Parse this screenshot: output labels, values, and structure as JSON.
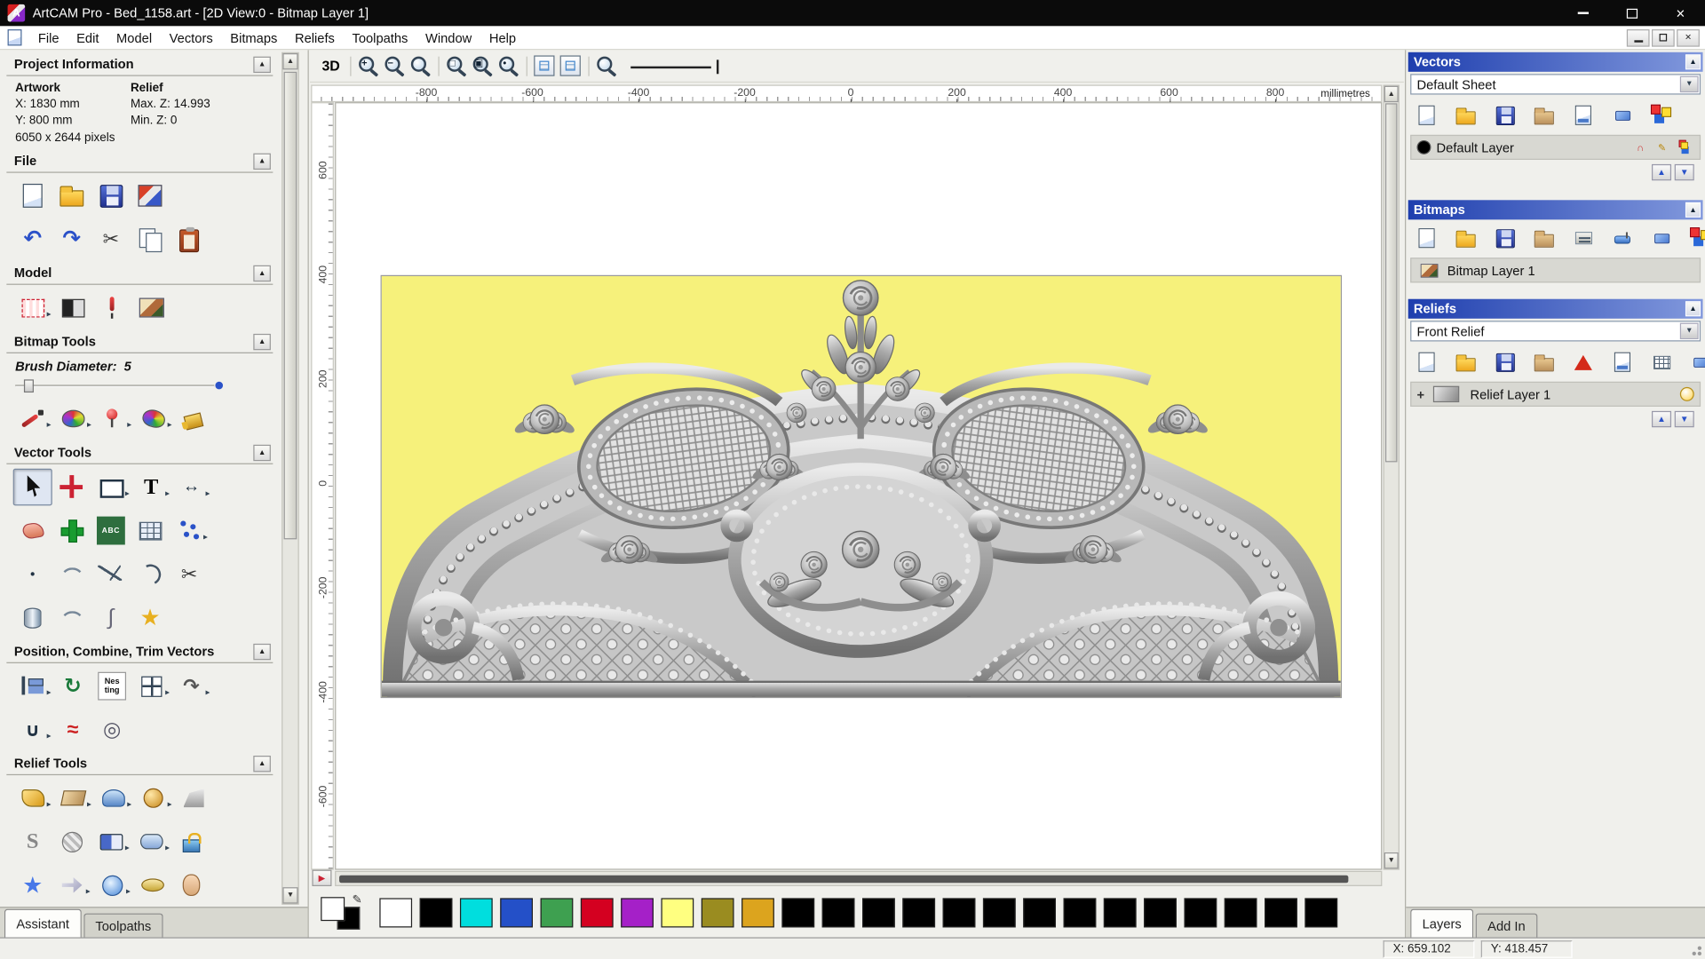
{
  "window": {
    "title": "ArtCAM Pro - Bed_1158.art - [2D View:0 - Bitmap Layer 1]",
    "logo_letter": "A"
  },
  "menu": {
    "items": [
      "File",
      "Edit",
      "Model",
      "Vectors",
      "Bitmaps",
      "Reliefs",
      "Toolpaths",
      "Window",
      "Help"
    ]
  },
  "glyphs": {
    "close": "×",
    "up": "▲",
    "down": "▼",
    "left": "◀",
    "right": "▶",
    "flyout": "▸",
    "dropdown": "▼",
    "undo": "↶",
    "redo": "↷",
    "cut": "✂",
    "trim": "✂",
    "pencil": "✎",
    "star": "★",
    "r-star": "★",
    "text": "T",
    "measure": "↔",
    "spinring": "↻",
    "rotcopy": "↷",
    "join": "∪",
    "weld": "≈",
    "abc": "ABC",
    "nesting": "Nes\nting",
    "magnet": "∩",
    "flourish": "∫",
    "spiral": "◎",
    "r-s": "S",
    "smalldot": "•",
    "plus": "+"
  },
  "left_panel": {
    "project_info": {
      "title": "Project Information",
      "artwork_label": "Artwork",
      "relief_label": "Relief",
      "x": "X: 1830 mm",
      "y": "Y: 800 mm",
      "max_z": "Max. Z: 14.993",
      "min_z": "Min. Z: 0",
      "pixels": "6050 x 2644 pixels"
    },
    "sections": {
      "file": "File",
      "model": "Model",
      "bitmap_tools": "Bitmap Tools",
      "vector_tools": "Vector Tools",
      "position_combine": "Position, Combine, Trim Vectors",
      "relief_tools": "Relief Tools"
    },
    "brush": {
      "label": "Brush Diameter:",
      "value": "5"
    },
    "strips": {
      "file1": [
        {
          "n": "new-model",
          "t": "page"
        },
        {
          "n": "open-model",
          "t": "folder"
        },
        {
          "n": "save-model",
          "t": "floppy"
        },
        {
          "n": "import-export-model",
          "t": "model3d"
        }
      ],
      "file2": [
        {
          "n": "undo",
          "t": "undo"
        },
        {
          "n": "redo",
          "t": "redo"
        },
        {
          "n": "cut",
          "t": "cut"
        },
        {
          "n": "copy",
          "t": "copy"
        },
        {
          "n": "paste",
          "t": "paste"
        }
      ],
      "model": [
        {
          "n": "set-model-size",
          "t": "modelgrid",
          "f": 1
        },
        {
          "n": "invert-model",
          "t": "invert"
        },
        {
          "n": "adjust-model",
          "t": "pin2"
        },
        {
          "n": "load-reference-image",
          "t": "picture"
        }
      ],
      "bitmap": [
        {
          "n": "paint",
          "t": "brush",
          "f": 1
        },
        {
          "n": "colour-palette",
          "t": "palette",
          "f": 1
        },
        {
          "n": "draw",
          "t": "pin",
          "f": 1
        },
        {
          "n": "flood-fill",
          "t": "palette2",
          "f": 1
        },
        {
          "n": "bucket-fill",
          "t": "bucket"
        }
      ],
      "vector1": [
        {
          "n": "select-vectors",
          "t": "select",
          "active": 1
        },
        {
          "n": "transform-vectors",
          "t": "transform"
        },
        {
          "n": "create-rectangle",
          "t": "rect",
          "f": 1
        },
        {
          "n": "create-text",
          "t": "text",
          "f": 1
        },
        {
          "n": "measure",
          "t": "measure",
          "f": 1
        }
      ],
      "vector2": [
        {
          "n": "offset-vectors",
          "t": "pinkblob"
        },
        {
          "n": "node-editing",
          "t": "greencross"
        },
        {
          "n": "text-in-box",
          "t": "abc"
        },
        {
          "n": "paste-in-grid",
          "t": "grid2"
        },
        {
          "n": "snap-points",
          "t": "dots",
          "f": 1
        }
      ],
      "vector3": [
        {
          "n": "create-dot",
          "t": "smalldot"
        },
        {
          "n": "create-curve",
          "t": "curve"
        },
        {
          "n": "create-polyline",
          "t": "polyline"
        },
        {
          "n": "create-arc",
          "t": "arcline"
        },
        {
          "n": "trim-vectors",
          "t": "trim"
        }
      ],
      "vector4": [
        {
          "n": "create-cylinder",
          "t": "cylinder"
        },
        {
          "n": "wrap-vectors",
          "t": "curve"
        },
        {
          "n": "create-flourish",
          "t": "flourish"
        },
        {
          "n": "create-star",
          "t": "star"
        }
      ],
      "poscomb1": [
        {
          "n": "align-vectors",
          "t": "align",
          "f": 1
        },
        {
          "n": "rotate-vectors",
          "t": "spinring"
        },
        {
          "n": "nesting",
          "t": "nesting"
        },
        {
          "n": "block-copy",
          "t": "blockcopy",
          "f": 1
        },
        {
          "n": "rotate-copy",
          "t": "rotcopy",
          "f": 1
        }
      ],
      "poscomb2": [
        {
          "n": "join-vectors",
          "t": "join",
          "f": 1
        },
        {
          "n": "weld-vectors",
          "t": "weld"
        },
        {
          "n": "create-spiral",
          "t": "spiral"
        }
      ],
      "relief1": [
        {
          "n": "shape-editor",
          "t": "r-gold",
          "f": 1
        },
        {
          "n": "angled-plane",
          "t": "r-plane",
          "f": 1
        },
        {
          "n": "smooth-relief",
          "t": "r-smooth",
          "f": 1
        },
        {
          "n": "sculpt-relief",
          "t": "r-sculpt",
          "f": 1
        },
        {
          "n": "scale-relief",
          "t": "r-scale"
        }
      ],
      "relief2": [
        {
          "n": "smooth-tool",
          "t": "r-s"
        },
        {
          "n": "texture-relief",
          "t": "r-weave"
        },
        {
          "n": "offset-relief",
          "t": "r-book",
          "f": 1
        },
        {
          "n": "relief-envelope",
          "t": "r-env",
          "f": 1
        },
        {
          "n": "wrap-relief",
          "t": "r-lock"
        }
      ],
      "relief3": [
        {
          "n": "two-rail-sweep",
          "t": "r-star"
        },
        {
          "n": "extrude-relief",
          "t": "r-extrude",
          "f": 1
        },
        {
          "n": "spin-relief",
          "t": "r-spin",
          "f": 1
        },
        {
          "n": "turn-relief",
          "t": "r-turn"
        },
        {
          "n": "face-wizard",
          "t": "r-face"
        }
      ],
      "relief4": [
        {
          "n": "relief-extra-1",
          "t": "r-sculpt"
        },
        {
          "n": "relief-extra-2",
          "t": "r-weave"
        },
        {
          "n": "relief-extra-3",
          "t": "r-smooth"
        },
        {
          "n": "relief-extra-4",
          "t": "r-gold"
        }
      ]
    },
    "tabs": [
      "Assistant",
      "Toolpaths"
    ]
  },
  "canvas": {
    "toolbar": {
      "view3d": "3D"
    },
    "ruler_unit": "millimetres",
    "h_ticks": [
      "-800",
      "-600",
      "-400",
      "-200",
      "0",
      "200",
      "400",
      "600",
      "800"
    ],
    "v_ticks": [
      "600",
      "400",
      "200",
      "0",
      "-200",
      "-400",
      "-600"
    ]
  },
  "right_panel": {
    "vectors": {
      "title": "Vectors",
      "sheet": "Default Sheet",
      "layer": "Default Layer",
      "toolbar": [
        {
          "n": "new-vector-layer",
          "t": "page"
        },
        {
          "n": "open-vector-layer",
          "t": "folder"
        },
        {
          "n": "save-vector-layer",
          "t": "floppy"
        },
        {
          "n": "import-vectors",
          "t": "folder2"
        },
        {
          "n": "export-vectors",
          "t": "page2"
        },
        {
          "n": "delete-vector-layer",
          "t": "eraser"
        },
        {
          "n": "merge-vector-layers",
          "t": "merge"
        }
      ],
      "layer_icons": [
        {
          "n": "toggle-layer-snap",
          "t": "magnet"
        },
        {
          "n": "edit-layer-colour",
          "t": "pencil"
        },
        {
          "n": "merge-layer",
          "t": "merge"
        }
      ]
    },
    "bitmaps": {
      "title": "Bitmaps",
      "layer": "Bitmap Layer 1",
      "toolbar": [
        {
          "n": "new-bitmap-layer",
          "t": "page"
        },
        {
          "n": "open-bitmap-layer",
          "t": "folder"
        },
        {
          "n": "save-bitmap-layer",
          "t": "floppy"
        },
        {
          "n": "import-bitmap",
          "t": "folder2"
        },
        {
          "n": "adjust-bitmap",
          "t": "slider"
        },
        {
          "n": "paint-bitmap",
          "t": "roller"
        },
        {
          "n": "delete-bitmap-layer",
          "t": "eraser"
        },
        {
          "n": "merge-bitmap-layers",
          "t": "merge"
        }
      ]
    },
    "reliefs": {
      "title": "Reliefs",
      "dropdown": "Front Relief",
      "layer": "Relief Layer 1",
      "toolbar": [
        {
          "n": "new-relief-layer",
          "t": "page"
        },
        {
          "n": "open-relief-layer",
          "t": "folder"
        },
        {
          "n": "save-relief-layer",
          "t": "floppy"
        },
        {
          "n": "import-relief",
          "t": "folder2"
        },
        {
          "n": "relief-wizard",
          "t": "pyramid"
        },
        {
          "n": "export-relief",
          "t": "page2"
        },
        {
          "n": "relief-grid",
          "t": "grid"
        },
        {
          "n": "delete-relief-layer",
          "t": "eraser"
        },
        {
          "n": "merge-relief-layers",
          "t": "merge"
        }
      ]
    },
    "tabs": [
      "Layers",
      "Add In"
    ]
  },
  "palette": {
    "colors": [
      "#ffffff",
      "#000000",
      "#00dede",
      "#2450c8",
      "#3ea050",
      "#d40020",
      "#a520c8",
      "#ffff80",
      "#9a8c20",
      "#dca41e",
      "#000000",
      "#000000",
      "#000000",
      "#000000",
      "#000000",
      "#000000",
      "#000000",
      "#000000",
      "#000000",
      "#000000",
      "#000000",
      "#000000",
      "#000000",
      "#000000"
    ]
  },
  "status": {
    "x": "X: 659.102",
    "y": "Y: 418.457"
  }
}
